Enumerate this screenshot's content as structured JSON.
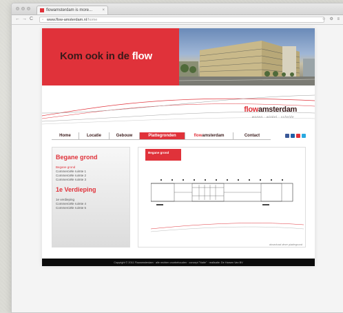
{
  "browser": {
    "tab_title": "flowamsterdam is more...",
    "tab_close": "×",
    "url_domain": "www.flow-amsterdam.nl",
    "url_path": "/home",
    "back": "←",
    "forward": "→",
    "reload": "C"
  },
  "hero": {
    "title_prefix": "Kom ook in de ",
    "title_highlight": "flow"
  },
  "logo": {
    "part1": "flow",
    "part2": "amsterdam",
    "tagline": "wonen · winkel · schelde"
  },
  "menu": [
    {
      "label": "Home"
    },
    {
      "label": "Locatie"
    },
    {
      "label": "Gebouw"
    },
    {
      "label": "Plattegronden",
      "active": true
    },
    {
      "label_red": "flow",
      "label_dark": "amsterdam"
    },
    {
      "label": "Contact"
    }
  ],
  "social": {
    "colors": [
      "#3b5998",
      "#1f5fa8",
      "#e0323a",
      "#2aa9e0"
    ],
    "icons": [
      "facebook-icon",
      "linkedin-icon",
      "google-icon",
      "twitter-icon"
    ]
  },
  "sidebar": {
    "section1_title": "Begane grond",
    "section1_items": [
      "Begane grond",
      "Commerciële ruimte 1",
      "Commerciële ruimte 2",
      "Commerciële ruimte 3"
    ],
    "section2_title": "1e Verdieping",
    "section2_items": [
      "1e verdieping",
      "Commerciële ruimte 4",
      "Commerciële ruimte 5"
    ]
  },
  "content": {
    "tab_label": "Begane grond",
    "caption": "download deze plattegrond"
  },
  "footer": {
    "text": "Copyright © 2011 Flowamsterdam · alle rechten voorbehouden · concept \"Natie\" · realisatie: De Harsen Van BV"
  },
  "colors": {
    "accent": "#e0323a",
    "dark": "#3a1a1a",
    "footer": "#0b0b0b"
  }
}
